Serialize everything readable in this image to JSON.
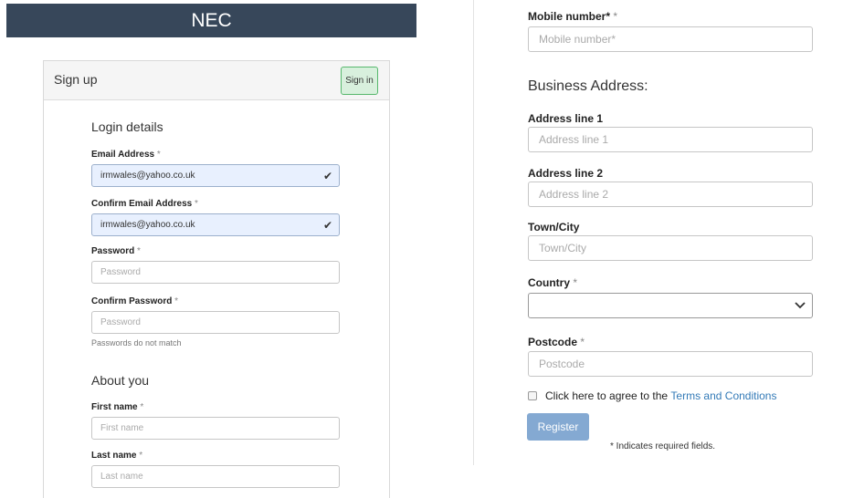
{
  "brand": "NEC",
  "signup": {
    "title": "Sign up",
    "signin_label": "Sign in",
    "login_section": "Login details",
    "email_label": "Email Address",
    "email_value": "irmwales@yahoo.co.uk",
    "confirm_email_label": "Confirm Email Address",
    "confirm_email_value": "irmwales@yahoo.co.uk",
    "password_label": "Password",
    "password_placeholder": "Password",
    "confirm_password_label": "Confirm Password",
    "confirm_password_placeholder": "Password",
    "password_help": "Passwords do not match",
    "about_section": "About you",
    "first_name_label": "First name",
    "first_name_placeholder": "First name",
    "last_name_label": "Last name",
    "last_name_placeholder": "Last name",
    "required_mark": "*"
  },
  "right": {
    "mobile_label": "Mobile number*",
    "mobile_placeholder": "Mobile number*",
    "business_title": "Business Address:",
    "address1_label": "Address line 1",
    "address1_placeholder": "Address line 1",
    "address2_label": "Address line 2",
    "address2_placeholder": "Address line 2",
    "town_label": "Town/City",
    "town_placeholder": "Town/City",
    "country_label": "Country",
    "country_value": "",
    "postcode_label": "Postcode",
    "postcode_placeholder": "Postcode",
    "terms_text": "Click here to agree to the ",
    "terms_link": "Terms and Conditions",
    "register_label": "Register",
    "required_note": "* Indicates required fields.",
    "required_mark": "*"
  },
  "icons": {
    "valid": "check-icon",
    "dropdown": "chevron-down-icon"
  },
  "colors": {
    "brand_bar": "#37475a",
    "signin_bg": "#d8f0dd",
    "signin_border": "#57b86d",
    "autofill": "#e8f0fe",
    "register_bg": "#84a9d2",
    "link": "#337ab7"
  }
}
